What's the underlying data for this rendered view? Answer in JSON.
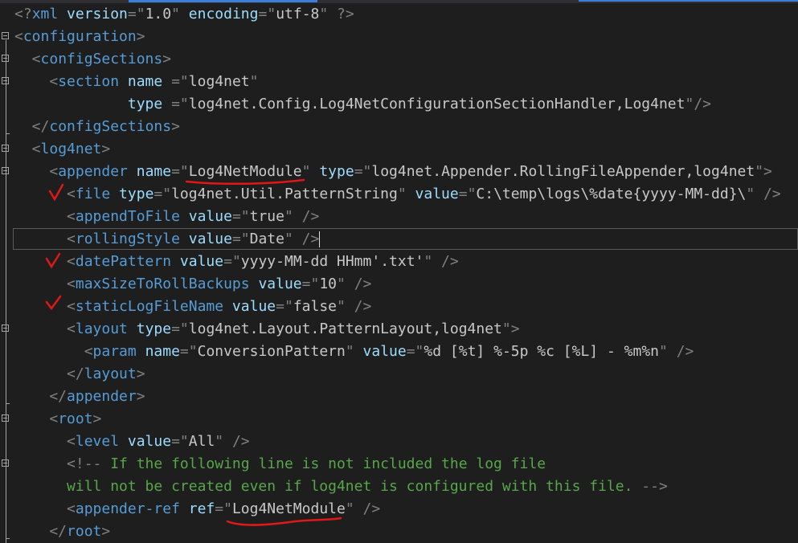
{
  "lines": [
    {
      "parts": [
        [
          "d",
          "<?"
        ],
        [
          "t",
          "xml"
        ],
        [
          "a",
          " version"
        ],
        [
          "d",
          "=\""
        ],
        [
          "v",
          "1.0"
        ],
        [
          "d",
          "\""
        ],
        [
          "a",
          " encoding"
        ],
        [
          "d",
          "=\""
        ],
        [
          "v",
          "utf-8"
        ],
        [
          "d",
          "\""
        ],
        [
          "d",
          " ?>"
        ]
      ]
    },
    {
      "parts": [
        [
          "d",
          "<"
        ],
        [
          "t",
          "configuration"
        ],
        [
          "d",
          ">"
        ]
      ]
    },
    {
      "parts": [
        [
          "d",
          "  <"
        ],
        [
          "t",
          "configSections"
        ],
        [
          "d",
          ">"
        ]
      ]
    },
    {
      "parts": [
        [
          "d",
          "    <"
        ],
        [
          "t",
          "section"
        ],
        [
          "a",
          " name "
        ],
        [
          "d",
          "=\""
        ],
        [
          "v",
          "log4net"
        ],
        [
          "d",
          "\""
        ]
      ]
    },
    {
      "parts": [
        [
          "a",
          "             type "
        ],
        [
          "d",
          "=\""
        ],
        [
          "v",
          "log4net.Config.Log4NetConfigurationSectionHandler,Log4net"
        ],
        [
          "d",
          "\"/>"
        ]
      ]
    },
    {
      "parts": [
        [
          "d",
          "  </"
        ],
        [
          "t",
          "configSections"
        ],
        [
          "d",
          ">"
        ]
      ]
    },
    {
      "parts": [
        [
          "d",
          "  <"
        ],
        [
          "t",
          "log4net"
        ],
        [
          "d",
          ">"
        ]
      ]
    },
    {
      "parts": [
        [
          "d",
          "    <"
        ],
        [
          "t",
          "appender"
        ],
        [
          "a",
          " name"
        ],
        [
          "d",
          "=\""
        ],
        [
          "v",
          "Log4NetModule"
        ],
        [
          "d",
          "\""
        ],
        [
          "a",
          " type"
        ],
        [
          "d",
          "=\""
        ],
        [
          "v",
          "log4net.Appender.RollingFileAppender,log4net"
        ],
        [
          "d",
          "\">"
        ]
      ]
    },
    {
      "parts": [
        [
          "d",
          "      <"
        ],
        [
          "t",
          "file"
        ],
        [
          "a",
          " type"
        ],
        [
          "d",
          "=\""
        ],
        [
          "v",
          "log4net.Util.PatternString"
        ],
        [
          "d",
          "\""
        ],
        [
          "a",
          " value"
        ],
        [
          "d",
          "=\""
        ],
        [
          "v",
          "C:\\temp\\logs\\%date{yyyy-MM-dd}\\"
        ],
        [
          "d",
          "\""
        ],
        [
          "d",
          " />"
        ]
      ]
    },
    {
      "parts": [
        [
          "d",
          "      <"
        ],
        [
          "t",
          "appendToFile"
        ],
        [
          "a",
          " value"
        ],
        [
          "d",
          "=\""
        ],
        [
          "v",
          "true"
        ],
        [
          "d",
          "\""
        ],
        [
          "d",
          " />"
        ]
      ]
    },
    {
      "parts": [
        [
          "d",
          "      <"
        ],
        [
          "t",
          "rollingStyle"
        ],
        [
          "a",
          " value"
        ],
        [
          "d",
          "=\""
        ],
        [
          "v",
          "Date"
        ],
        [
          "d",
          "\""
        ],
        [
          "d",
          " />"
        ]
      ],
      "caret": true
    },
    {
      "parts": [
        [
          "d",
          "      <"
        ],
        [
          "t",
          "datePattern"
        ],
        [
          "a",
          " value"
        ],
        [
          "d",
          "=\""
        ],
        [
          "v",
          "yyyy-MM-dd HHmm'.txt'"
        ],
        [
          "d",
          "\""
        ],
        [
          "d",
          " />"
        ]
      ]
    },
    {
      "parts": [
        [
          "d",
          "      <"
        ],
        [
          "t",
          "maxSizeToRollBackups"
        ],
        [
          "a",
          " value"
        ],
        [
          "d",
          "=\""
        ],
        [
          "v",
          "10"
        ],
        [
          "d",
          "\""
        ],
        [
          "d",
          " />"
        ]
      ]
    },
    {
      "parts": [
        [
          "d",
          "      <"
        ],
        [
          "t",
          "staticLogFileName"
        ],
        [
          "a",
          " value"
        ],
        [
          "d",
          "=\""
        ],
        [
          "v",
          "false"
        ],
        [
          "d",
          "\""
        ],
        [
          "d",
          " />"
        ]
      ]
    },
    {
      "parts": [
        [
          "d",
          "      <"
        ],
        [
          "t",
          "layout"
        ],
        [
          "a",
          " type"
        ],
        [
          "d",
          "=\""
        ],
        [
          "v",
          "log4net.Layout.PatternLayout,log4net"
        ],
        [
          "d",
          "\">"
        ]
      ]
    },
    {
      "parts": [
        [
          "d",
          "        <"
        ],
        [
          "t",
          "param"
        ],
        [
          "a",
          " name"
        ],
        [
          "d",
          "=\""
        ],
        [
          "v",
          "ConversionPattern"
        ],
        [
          "d",
          "\""
        ],
        [
          "a",
          " value"
        ],
        [
          "d",
          "=\""
        ],
        [
          "v",
          "%d [%t] %-5p %c [%L] - %m%n"
        ],
        [
          "d",
          "\""
        ],
        [
          "d",
          " />"
        ]
      ]
    },
    {
      "parts": [
        [
          "d",
          "      </"
        ],
        [
          "t",
          "layout"
        ],
        [
          "d",
          ">"
        ]
      ]
    },
    {
      "parts": [
        [
          "d",
          "    </"
        ],
        [
          "t",
          "appender"
        ],
        [
          "d",
          ">"
        ]
      ]
    },
    {
      "parts": [
        [
          "d",
          "    <"
        ],
        [
          "t",
          "root"
        ],
        [
          "d",
          ">"
        ]
      ]
    },
    {
      "parts": [
        [
          "d",
          "      <"
        ],
        [
          "t",
          "level"
        ],
        [
          "a",
          " value"
        ],
        [
          "d",
          "=\""
        ],
        [
          "v",
          "All"
        ],
        [
          "d",
          "\""
        ],
        [
          "d",
          " />"
        ]
      ]
    },
    {
      "parts": [
        [
          "d",
          "      <!--"
        ],
        [
          "c",
          " If the following line is not included the log file"
        ]
      ]
    },
    {
      "parts": [
        [
          "c",
          "      will not be created even if log4net is configured with this file. "
        ],
        [
          "d",
          "-->"
        ]
      ]
    },
    {
      "parts": [
        [
          "d",
          "      <"
        ],
        [
          "t",
          "appender-ref"
        ],
        [
          "a",
          " ref"
        ],
        [
          "d",
          "=\""
        ],
        [
          "v",
          "Log4NetModule"
        ],
        [
          "d",
          "\""
        ],
        [
          "d",
          " />"
        ]
      ]
    },
    {
      "parts": [
        [
          "d",
          "    </"
        ],
        [
          "t",
          "root"
        ],
        [
          "d",
          ">"
        ]
      ]
    }
  ],
  "folds": [
    1,
    2,
    3,
    6,
    7,
    14,
    18,
    20
  ],
  "colors": {
    "background": "#1e1e1e",
    "tag": "#569cd6",
    "attribute": "#9cdcfe",
    "delimiter": "#808080",
    "value": "#c8c8c8",
    "comment": "#57a64a",
    "annotation": "#e01818"
  }
}
